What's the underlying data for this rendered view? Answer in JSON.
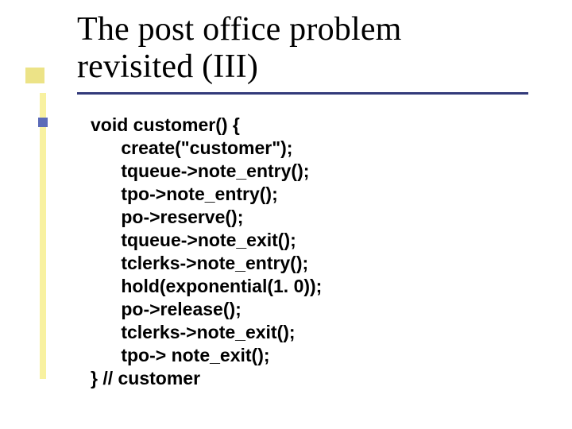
{
  "title": {
    "line1": "The post office problem",
    "line2": "revisited (III)"
  },
  "code": {
    "l0": "void customer() {",
    "l1": "      create(\"customer\");",
    "l2": "      tqueue->note_entry();",
    "l3": "      tpo->note_entry();",
    "l4": "      po->reserve();",
    "l5": "      tqueue->note_exit();",
    "l6": "      tclerks->note_entry();",
    "l7": "      hold(exponential(1. 0));",
    "l8": "      po->release();",
    "l9": "      tclerks->note_exit();",
    "l10": "      tpo-> note_exit();",
    "l11": "} // customer"
  }
}
